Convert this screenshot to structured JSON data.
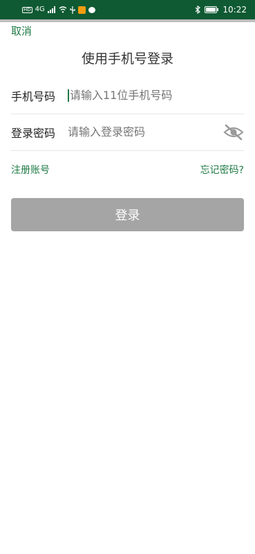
{
  "status_bar": {
    "network": "4G",
    "time": "10:22"
  },
  "header": {
    "cancel_label": "取消",
    "title": "使用手机号登录"
  },
  "form": {
    "phone": {
      "label": "手机号码",
      "placeholder": "请输入11位手机号码"
    },
    "password": {
      "label": "登录密码",
      "placeholder": "请输入登录密码"
    }
  },
  "links": {
    "register_label": "注册账号",
    "forgot_label": "忘记密码?"
  },
  "actions": {
    "login_label": "登录"
  },
  "colors": {
    "statusbar": "#0f5a33",
    "accent_green": "#1f7a45",
    "button_disabled": "#a5a5a5"
  }
}
